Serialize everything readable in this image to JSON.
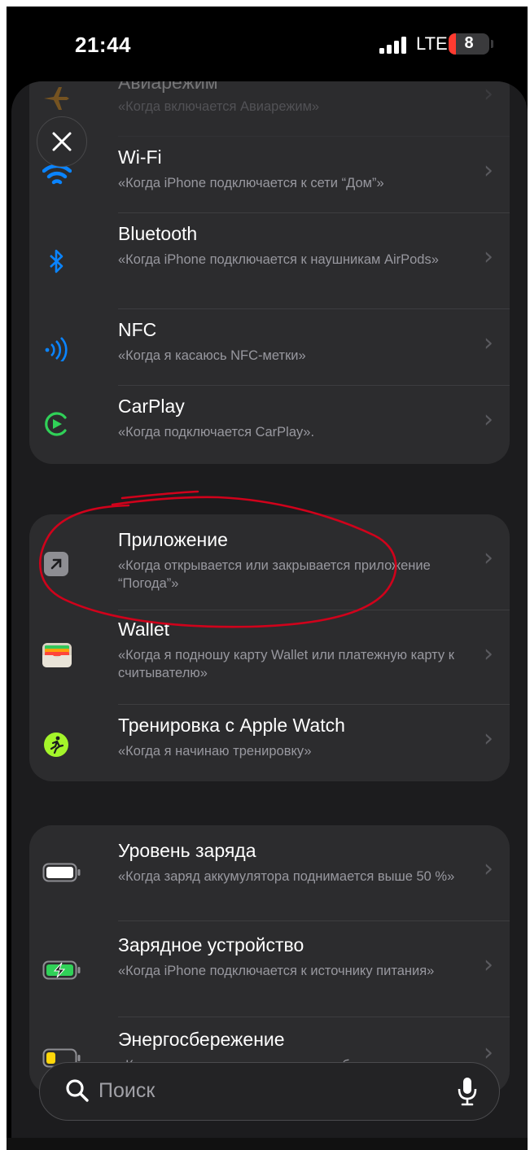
{
  "status_bar": {
    "time": "21:44",
    "network": "LTE",
    "battery": "8"
  },
  "sections": [
    {
      "rows": [
        {
          "title": "Авиарежим",
          "subtitle": "«Когда включается Авиарежим»",
          "icon": "airplane-icon"
        },
        {
          "title": "Wi-Fi",
          "subtitle": "«Когда iPhone подключается к сети “Дом”»",
          "icon": "wifi-icon"
        },
        {
          "title": "Bluetooth",
          "subtitle": "«Когда iPhone подключается к наушникам AirPods»",
          "icon": "bluetooth-icon"
        },
        {
          "title": "NFC",
          "subtitle": "«Когда я касаюсь NFC-метки»",
          "icon": "nfc-icon"
        },
        {
          "title": "CarPlay",
          "subtitle": "«Когда подключается CarPlay».",
          "icon": "carplay-icon"
        }
      ]
    },
    {
      "rows": [
        {
          "title": "Приложение",
          "subtitle": "«Когда открывается или закрывается приложение “Погода”»",
          "icon": "app-open-icon"
        },
        {
          "title": "Wallet",
          "subtitle": "«Когда я подношу карту Wallet или платежную карту к считывателю»",
          "icon": "wallet-icon"
        },
        {
          "title": "Тренировка с Apple Watch",
          "subtitle": "«Когда я начинаю тренировку»",
          "icon": "workout-icon"
        }
      ]
    },
    {
      "rows": [
        {
          "title": "Уровень заряда",
          "subtitle": "«Когда заряд аккумулятора поднимается выше 50 %»",
          "icon": "battery-level-icon"
        },
        {
          "title": "Зарядное устройство",
          "subtitle": "«Когда iPhone подключается к источнику питания»",
          "icon": "charger-icon"
        },
        {
          "title": "Энергосбережение",
          "subtitle": "«Когда выключается режим энергосбережения»",
          "icon": "low-power-icon"
        }
      ]
    }
  ],
  "search": {
    "placeholder": "Поиск"
  },
  "colors": {
    "accent_blue": "#0a84ff",
    "green": "#30d158",
    "annotation_red": "#d0021b"
  }
}
